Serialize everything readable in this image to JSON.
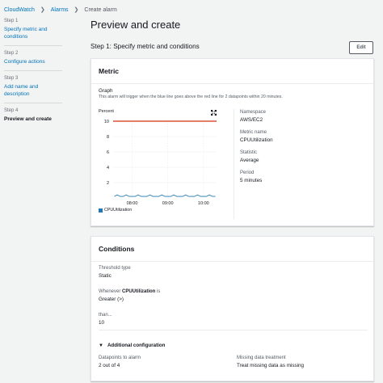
{
  "breadcrumb": {
    "items": [
      "CloudWatch",
      "Alarms",
      "Create alarm"
    ]
  },
  "steps": [
    {
      "num": "Step 1",
      "label": "Specify metric and conditions"
    },
    {
      "num": "Step 2",
      "label": "Configure actions"
    },
    {
      "num": "Step 3",
      "label": "Add name and description"
    },
    {
      "num": "Step 4",
      "label": "Preview and create"
    }
  ],
  "page": {
    "title": "Preview and create"
  },
  "step1": {
    "title": "Step 1: Specify metric and conditions",
    "edit_label": "Edit"
  },
  "metric": {
    "title": "Metric",
    "graph_title": "Graph",
    "graph_desc": "This alarm will trigger when the blue line goes above the red line for 2 datapoints within 20 minutes.",
    "y_label": "Percent",
    "legend": "CPUUtilization",
    "namespace_label": "Namespace",
    "namespace_value": "AWS/EC2",
    "metric_name_label": "Metric name",
    "metric_name_value": "CPUUtilization",
    "statistic_label": "Statistic",
    "statistic_value": "Average",
    "period_label": "Period",
    "period_value": "5 minutes"
  },
  "conditions": {
    "title": "Conditions",
    "threshold_type_label": "Threshold type",
    "threshold_type_value": "Static",
    "whenever_prefix": "Whenever ",
    "whenever_metric": "CPUUtilization",
    "whenever_suffix": " is",
    "whenever_value": "Greater (>)",
    "than_label": "than...",
    "than_value": "10",
    "additional_config": "Additional configuration",
    "datapoints_label": "Datapoints to alarm",
    "datapoints_value": "2 out of 4",
    "missing_label": "Missing data treatment",
    "missing_value": "Treat missing data as missing"
  },
  "chart_data": {
    "type": "line",
    "ylabel": "Percent",
    "ylim": [
      0,
      10
    ],
    "yticks": [
      2,
      4,
      6,
      8,
      10
    ],
    "xticks": [
      "08:00",
      "09:00",
      "10:00"
    ],
    "threshold": 10,
    "threshold_color": "#d13212",
    "series": [
      {
        "name": "CPUUtilization",
        "color": "#1f77b4",
        "x": [
          "07:30",
          "07:35",
          "07:40",
          "07:45",
          "07:50",
          "07:55",
          "08:00",
          "08:05",
          "08:10",
          "08:15",
          "08:20",
          "08:25",
          "08:30",
          "08:35",
          "08:40",
          "08:45",
          "08:50",
          "08:55",
          "09:00",
          "09:05",
          "09:10",
          "09:15",
          "09:20",
          "09:25",
          "09:30",
          "09:35",
          "09:40",
          "09:45",
          "09:50",
          "09:55",
          "10:00",
          "10:05",
          "10:10",
          "10:15",
          "10:20"
        ],
        "values": [
          0.2,
          0.4,
          0.2,
          0.2,
          0.4,
          0.2,
          0.2,
          0.2,
          0.4,
          0.2,
          0.2,
          0.2,
          0.4,
          0.2,
          0.2,
          0.2,
          0.4,
          0.2,
          0.2,
          0.2,
          0.4,
          0.2,
          0.2,
          0.2,
          0.4,
          0.2,
          0.2,
          0.2,
          0.4,
          0.2,
          0.2,
          0.2,
          0.4,
          0.2,
          0.2
        ]
      }
    ]
  }
}
